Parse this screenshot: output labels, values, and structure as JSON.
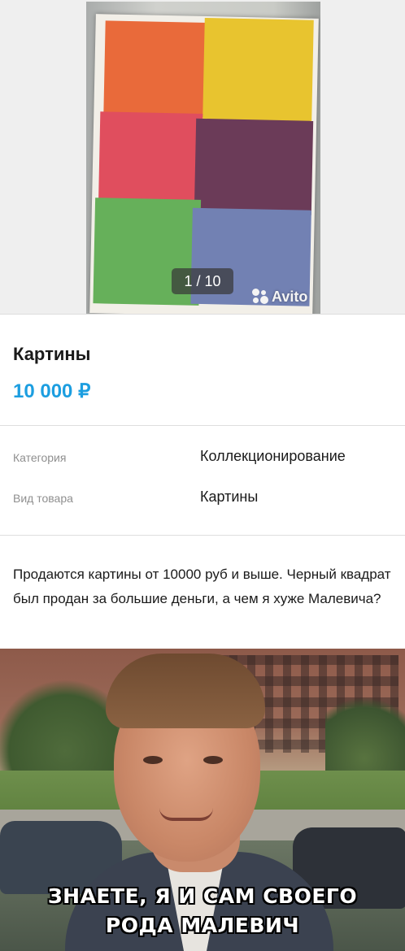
{
  "gallery": {
    "counter": "1 / 10",
    "watermark": "Avito"
  },
  "listing": {
    "title": "Картины",
    "price": "10 000 ₽"
  },
  "params": [
    {
      "label": "Категория",
      "value": "Коллекционирование"
    },
    {
      "label": "Вид товара",
      "value": "Картины"
    }
  ],
  "description": "Продаются картины от 10000 руб и выше. Черный квадрат был продан за большие деньги, а чем я хуже Малевича?",
  "meme": {
    "caption_line1": "ЗНАЕТЕ, Я И САМ СВОЕГО",
    "caption_line2": "РОДА МАЛЕВИЧ"
  },
  "colors": {
    "price": "#1c9ee0",
    "divider": "#dedede",
    "label": "#8f8f8f"
  }
}
